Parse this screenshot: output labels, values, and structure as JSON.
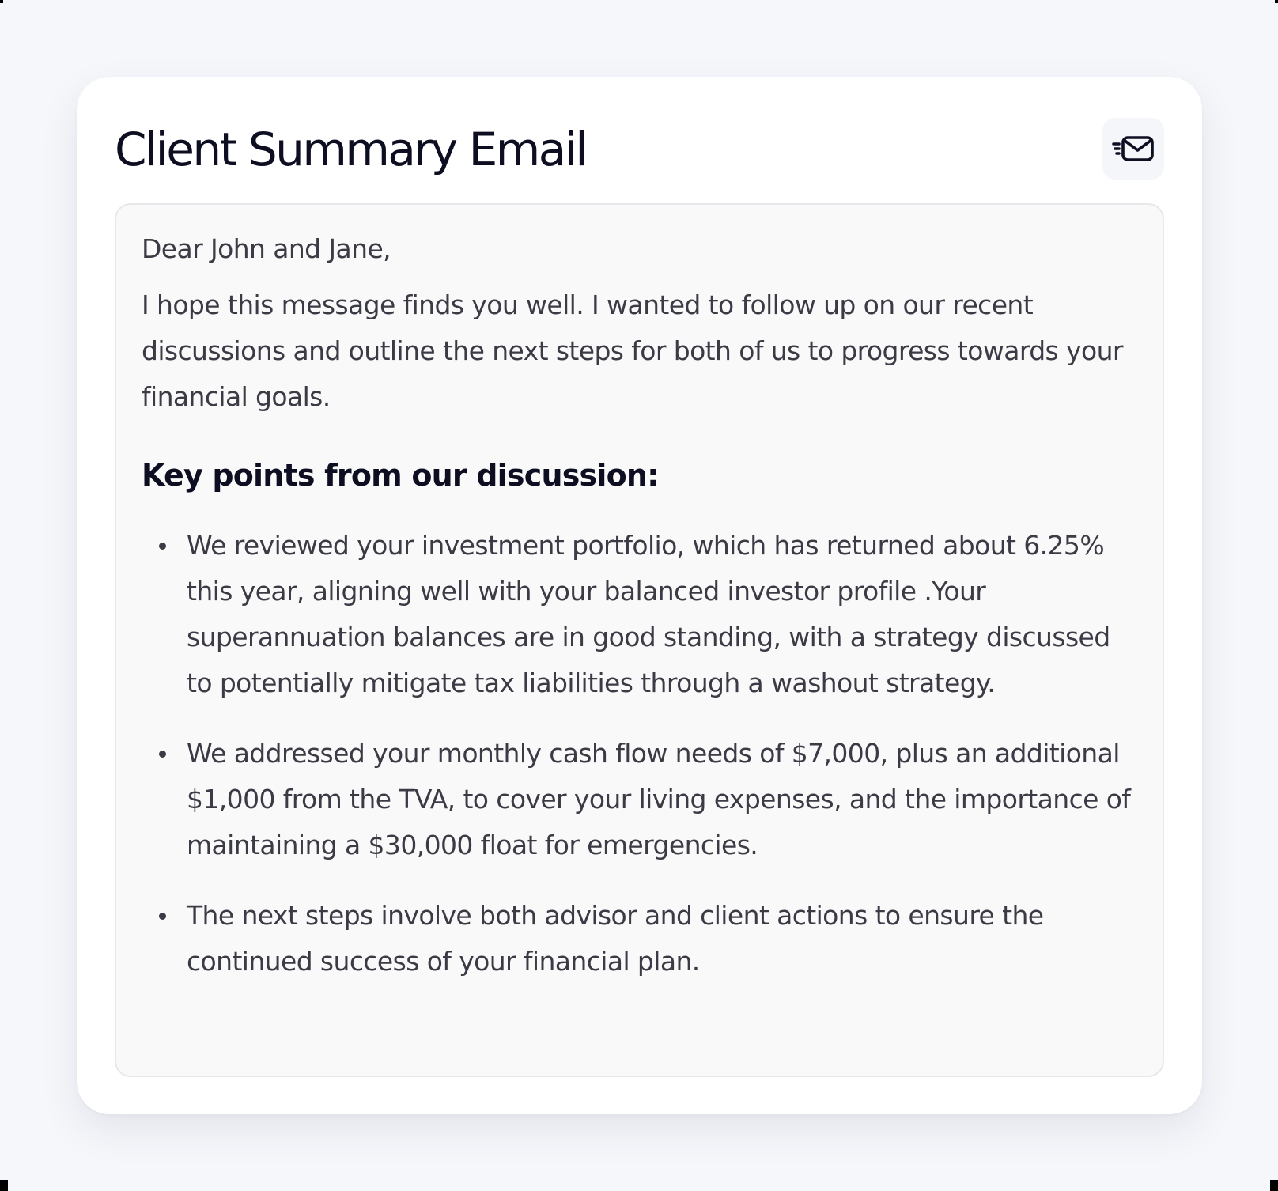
{
  "card": {
    "title": "Client Summary Email",
    "action_icon": "send-email-icon"
  },
  "email": {
    "greeting": "Dear John and Jane,",
    "intro": "I hope this message finds you well. I wanted to follow up on our recent discussions and outline the next steps for both of us to progress towards your financial goals.",
    "key_points_heading": "Key points from our discussion:",
    "points": [
      "We reviewed your investment portfolio, which has returned about 6.25% this year, aligning well with your balanced investor profile .Your superannuation balances are in good standing, with a strategy discussed to potentially mitigate tax liabilities through a washout strategy.",
      "We addressed your monthly cash flow needs of $7,000, plus an additional $1,000 from the TVA, to cover your living expenses, and the importance of maintaining a $30,000 float for emergencies.",
      "The next steps involve both advisor and client actions to ensure the continued success of your financial plan."
    ]
  },
  "colors": {
    "page_background": "#f6f7fb",
    "card_background": "#ffffff",
    "email_background": "#f9f9fa",
    "email_border": "#e8e8ec",
    "title_text": "#0e0e22",
    "body_text": "#3b3b45"
  }
}
